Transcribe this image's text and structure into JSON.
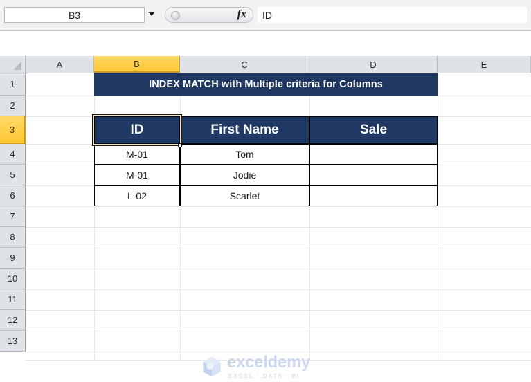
{
  "formula_bar": {
    "name_box_value": "B3",
    "name_box_dropdown_icon": "chevron-down-icon",
    "cancel_icon": "circle-icon",
    "fx_label": "fx",
    "formula_value": "ID"
  },
  "grid": {
    "select_all_icon": "select-all-triangle-icon",
    "column_headers": [
      "A",
      "B",
      "C",
      "D",
      "E"
    ],
    "active_column": "B",
    "row_headers": [
      "1",
      "2",
      "3",
      "4",
      "5",
      "6",
      "7",
      "8",
      "9",
      "10",
      "11",
      "12",
      "13"
    ],
    "active_row": "3"
  },
  "sheet": {
    "title": "INDEX MATCH with Multiple criteria for Columns",
    "table_headers": [
      "ID",
      "First Name",
      "Sale"
    ],
    "rows": [
      {
        "id": "M-01",
        "first_name": "Tom",
        "sale": ""
      },
      {
        "id": "M-01",
        "first_name": "Jodie",
        "sale": ""
      },
      {
        "id": "L-02",
        "first_name": "Scarlet",
        "sale": ""
      }
    ]
  },
  "watermark": {
    "name": "exceldemy",
    "tagline": "EXCEL · DATA · BI",
    "logo_icon": "exceldemy-cube-logo-icon"
  },
  "colors": {
    "header_navy": "#1f3864",
    "active_header_yellow": "#ffc833",
    "grid_line": "#e3e5e8",
    "watermark_blue": "#ccd8f0"
  }
}
